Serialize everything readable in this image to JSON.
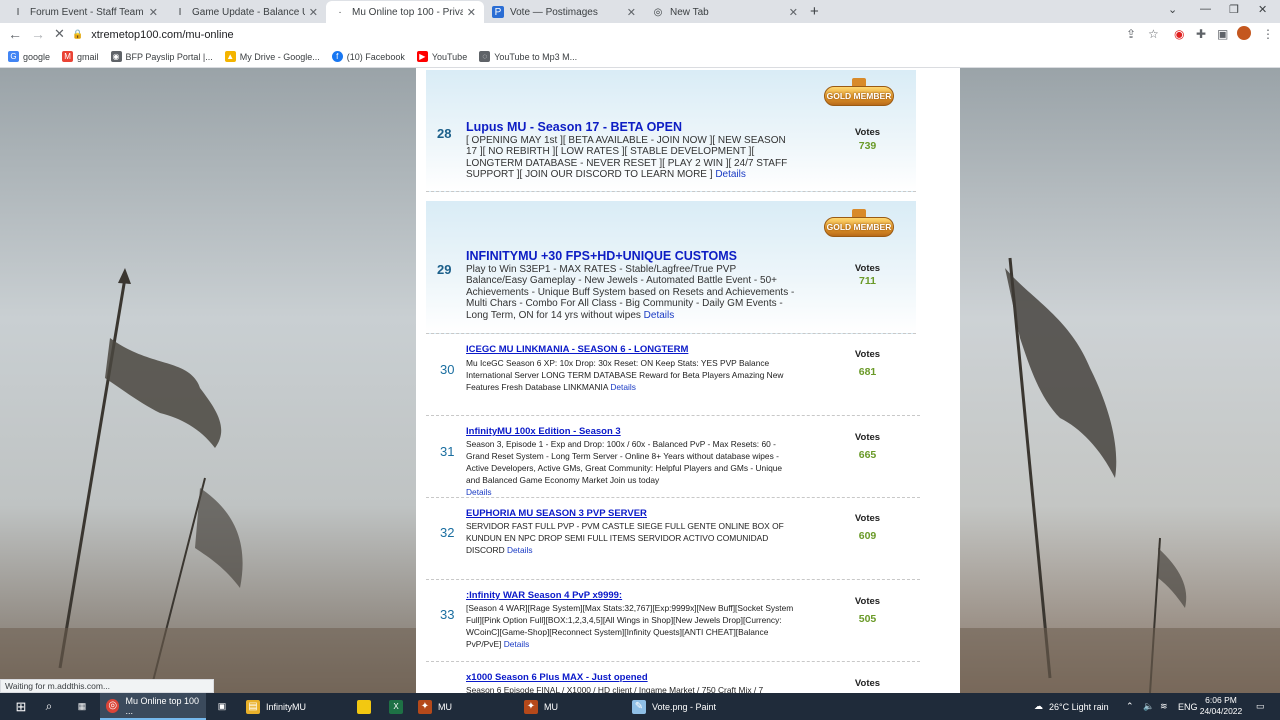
{
  "tabs": [
    {
      "label": "Forum Event - Staff Team Says! |",
      "icon": "I",
      "active": false
    },
    {
      "label": "Game Update - Balance Updates",
      "icon": "I",
      "active": false
    },
    {
      "label": "Mu Online top 100 - Private serv",
      "icon": "·",
      "active": true
    },
    {
      "label": "Vote — Postimages",
      "icon": "P",
      "active": false
    },
    {
      "label": "New Tab",
      "icon": "◎",
      "active": false
    }
  ],
  "toolbar": {
    "url": "xtremetop100.com/mu-online"
  },
  "bookmarks": [
    {
      "label": "google",
      "icon": "G",
      "color": "#4285f4"
    },
    {
      "label": "gmail",
      "icon": "M",
      "color": "#ea4335"
    },
    {
      "label": "BFP Payslip Portal |...",
      "icon": "◉",
      "color": "#5f6368"
    },
    {
      "label": "My Drive - Google...",
      "icon": "▲",
      "color": "#f4b400"
    },
    {
      "label": "(10) Facebook",
      "icon": "f",
      "color": "#1877f2"
    },
    {
      "label": "YouTube",
      "icon": "▶",
      "color": "#ff0000"
    },
    {
      "label": "YouTube to Mp3 M...",
      "icon": "◌",
      "color": "#5f6368"
    }
  ],
  "badge_text": "GOLD MEMBER",
  "votes_label": "Votes",
  "details_label": "Details",
  "entries": [
    {
      "rank": "28",
      "title": "Lupus MU - Season 17 - BETA OPEN",
      "desc": "[ OPENING MAY 1st ][ BETA AVAILABLE - JOIN NOW ][ NEW SEASON 17 ][ NO REBIRTH ][ LOW RATES ][ STABLE DEVELOPMENT ][ LONGTERM DATABASE - NEVER RESET ][ PLAY 2 WIN ][ 24/7 STAFF SUPPORT ][ JOIN OUR DISCORD TO LEARN MORE ]",
      "votes": "739",
      "gold": true
    },
    {
      "rank": "29",
      "title": "INFINITYMU +30 FPS+HD+UNIQUE CUSTOMS",
      "desc": "Play to Win S3EP1 - MAX RATES - Stable/Lagfree/True PVP Balance/Easy Gameplay - New Jewels - Automated Battle Event - 50+ Achievements - Unique Buff System based on Resets and Achievements - Multi Chars - Combo For All Class - Big Community - Daily GM Events - Long Term, ON for 14 yrs without wipes",
      "votes": "711",
      "gold": true
    },
    {
      "rank": "30",
      "title": "ICEGC MU LINKMANIA - SEASON 6 - LONGTERM",
      "desc": "Mu IceGC Season 6 XP: 10x Drop: 30x Reset: ON Keep Stats: YES PVP Balance International Server LONG TERM DATABASE Reward for Beta Players Amazing New Features Fresh Database LINKMANIA",
      "votes": "681",
      "gold": false
    },
    {
      "rank": "31",
      "title": "InfinityMU 100x Edition - Season 3",
      "desc": "Season 3, Episode 1 - Exp and Drop: 100x / 60x - Balanced PvP - Max Resets: 60 - Grand Reset System - Long Term Server - Online 8+ Years without database wipes - Active Developers, Active GMs, Great Community: Helpful Players and GMs - Unique and Balanced Game Economy Market Join us today",
      "votes": "665",
      "gold": false
    },
    {
      "rank": "32",
      "title": "EUPHORIA MU SEASON 3 PVP SERVER",
      "desc": "SERVIDOR FAST FULL PVP - PVM CASTLE SIEGE FULL GENTE ONLINE BOX OF KUNDUN EN NPC DROP SEMI FULL ITEMS SERVIDOR ACTIVO COMUNIDAD DISCORD",
      "votes": "609",
      "gold": false
    },
    {
      "rank": "33",
      "title": ":Infinity WAR Season 4 PvP x9999:",
      "desc": "[Season 4 WAR][Rage System][Max Stats:32,767][Exp:9999x][New Buff][Socket System Full][Pink Option Full][BOX:1,2,3,4,5][All Wings in Shop][New Jewels Drop][Currency: WCoinC][Game-Shop][Reconnect System][Infinity Quests][ANTI CHEAT][Balance PvP/PvE]",
      "votes": "505",
      "gold": false
    },
    {
      "rank": "",
      "title": "x1000 Season 6 Plus MAX - Just opened",
      "desc": "Season 6 Episode FINAL / X1000 / HD client / Ingame Market / 750 Craft Mix / 7",
      "votes": "",
      "gold": false
    }
  ],
  "status": "Waiting for m.addthis.com...",
  "taskbar": {
    "items": [
      {
        "label": "Mu Online top 100 ...",
        "icon": "◎"
      },
      {
        "label": "InfinityMU",
        "icon": "▤"
      },
      {
        "label": "MU",
        "icon": "✦"
      },
      {
        "label": "MU",
        "icon": "✦"
      },
      {
        "label": "Vote.png - Paint",
        "icon": "✎"
      }
    ],
    "weather": "26°C  Light rain",
    "lang": "ENG",
    "time": "6:06 PM",
    "date": "24/04/2022"
  }
}
